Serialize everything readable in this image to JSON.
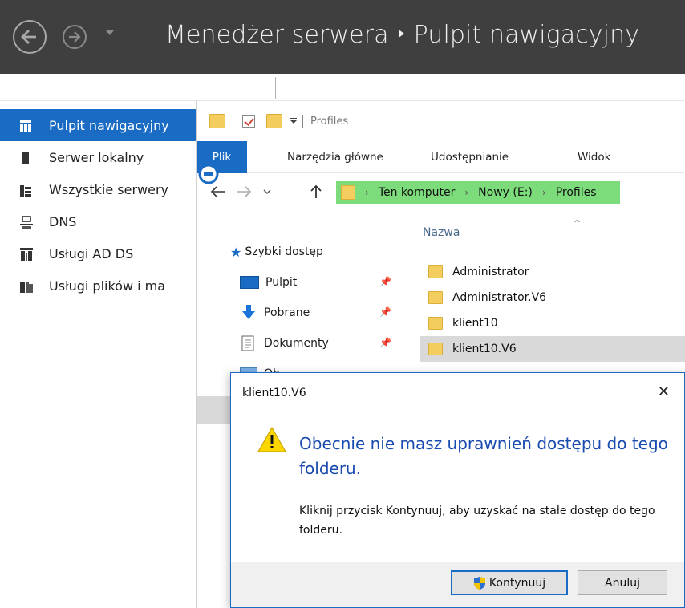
{
  "server_manager": {
    "breadcrumb": {
      "app": "Menedżer serwera",
      "page": "Pulpit nawigacyjny"
    },
    "sidebar": {
      "items": [
        {
          "label": "Pulpit nawigacyjny",
          "icon": "dashboard-icon",
          "active": true
        },
        {
          "label": "Serwer lokalny",
          "icon": "server-icon"
        },
        {
          "label": "Wszystkie serwery",
          "icon": "servers-icon"
        },
        {
          "label": "DNS",
          "icon": "dns-icon"
        },
        {
          "label": "Usługi AD DS",
          "icon": "ad-ds-icon"
        },
        {
          "label": "Usługi plików i ma",
          "icon": "file-services-icon"
        }
      ]
    }
  },
  "explorer": {
    "title": "Profiles",
    "tabs": [
      "Plik",
      "Narzędzia główne",
      "Udostępnianie",
      "Widok"
    ],
    "address": {
      "crumbs": [
        "Ten komputer",
        "Nowy (E:)",
        "Profiles"
      ]
    },
    "nav": {
      "quick_access": "Szybki dostęp",
      "items": [
        "Pulpit",
        "Pobrane",
        "Dokumenty",
        "Ob"
      ]
    },
    "files": {
      "column": "Nazwa",
      "rows": [
        {
          "name": "Administrator",
          "selected": false
        },
        {
          "name": "Administrator.V6",
          "selected": false
        },
        {
          "name": "klient10",
          "selected": false
        },
        {
          "name": "klient10.V6",
          "selected": true
        }
      ]
    }
  },
  "dialog": {
    "title": "klient10.V6",
    "close": "✕",
    "message": "Obecnie nie masz uprawnień dostępu do tego folderu.",
    "detail": "Kliknij przycisk Kontynuuj, aby uzyskać na stałe dostęp do tego folderu.",
    "continue_label": "Kontynuuj",
    "cancel_label": "Anuluj"
  },
  "colors": {
    "accent": "#1a6bc4",
    "header_bg": "#3f3f3f",
    "address_highlight": "#7cdb7a",
    "folder": "#f4cd5f",
    "warning": "#ffd700"
  }
}
